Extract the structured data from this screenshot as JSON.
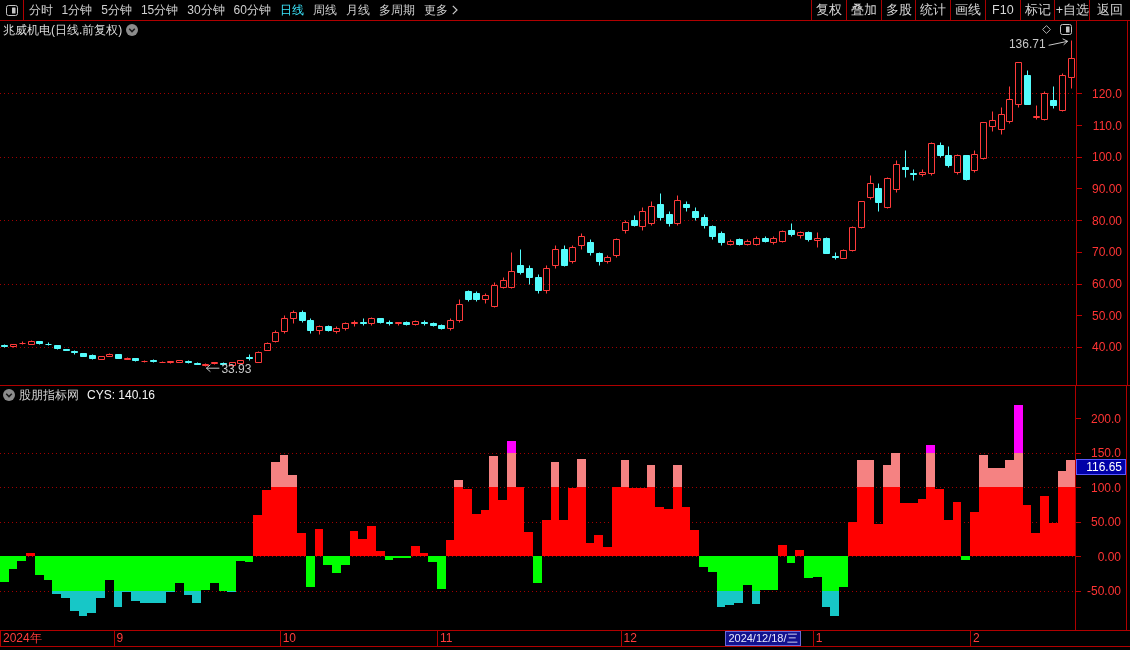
{
  "toolbar": {
    "tabs": [
      {
        "label": "分时",
        "selected": false,
        "kind": "period"
      },
      {
        "label": "1分钟",
        "selected": false,
        "kind": "period"
      },
      {
        "label": "5分钟",
        "selected": false,
        "kind": "period"
      },
      {
        "label": "15分钟",
        "selected": false,
        "kind": "period"
      },
      {
        "label": "30分钟",
        "selected": false,
        "kind": "period"
      },
      {
        "label": "60分钟",
        "selected": false,
        "kind": "period"
      },
      {
        "label": "日线",
        "selected": true,
        "kind": "period"
      },
      {
        "label": "周线",
        "selected": false,
        "kind": "period"
      },
      {
        "label": "月线",
        "selected": false,
        "kind": "period"
      },
      {
        "label": "多周期",
        "selected": false,
        "kind": "period"
      },
      {
        "label": "更多",
        "selected": false,
        "kind": "menu"
      }
    ],
    "buttons": [
      "复权",
      "叠加",
      "多股",
      "统计",
      "画线",
      "F10",
      "标记",
      "+自选",
      "返回"
    ]
  },
  "price_chart": {
    "title": "兆威机电(日线.前复权)",
    "axis_labels": [
      "120.0",
      "110.0",
      "100.0",
      "90.00",
      "80.00",
      "70.00",
      "60.00",
      "50.00",
      "40.00"
    ],
    "high_label": "136.71",
    "low_label": "33.93"
  },
  "indicator": {
    "name": "股朋指标网",
    "reading": "CYS: 140.16",
    "value_tag": "116.65",
    "chart_data": {
      "type": "bar",
      "ylim": [
        -107,
        246.5
      ],
      "grid": true,
      "yticks": [
        {
          "value": 200,
          "label": "200.0"
        },
        {
          "value": 150,
          "label": "150.0"
        },
        {
          "value": 100,
          "label": "100.0"
        },
        {
          "value": 50,
          "label": "50.00"
        },
        {
          "value": 0,
          "label": "0.00"
        },
        {
          "value": -50,
          "label": "-50.00"
        }
      ],
      "values": [
        -37,
        -18,
        -7,
        4,
        -28,
        -34,
        -55,
        -60,
        -80,
        -86,
        -83,
        -60,
        -35,
        -73,
        -52,
        -65,
        -68,
        -68,
        -68,
        -52,
        -39,
        -57,
        -68,
        -49,
        -39,
        -51,
        -52,
        -7,
        -9,
        59,
        96,
        136,
        146,
        117,
        33,
        -45,
        40,
        -13,
        -25,
        -13,
        36,
        25,
        43,
        7,
        -6,
        -3,
        -3,
        14,
        4,
        -9,
        -48,
        23,
        110,
        97,
        61,
        67,
        145,
        81,
        167,
        100,
        35,
        -39,
        52,
        136,
        52,
        99,
        141,
        19,
        30,
        13,
        100,
        140,
        99,
        99,
        132,
        71,
        68,
        132,
        71,
        38,
        -16,
        -23,
        -74,
        -71,
        -68,
        -42,
        -70,
        -49,
        -49,
        16,
        -10,
        9,
        -32,
        -30,
        -74,
        -86,
        -45,
        49,
        139,
        139,
        46,
        132,
        149,
        77,
        77,
        83,
        161,
        97,
        52,
        78,
        -6,
        64,
        146,
        128,
        128,
        139,
        219,
        74,
        33,
        87,
        48,
        123,
        140
      ]
    }
  },
  "time_axis": {
    "labels": [
      "2024年",
      "9",
      "10",
      "11",
      "12",
      "1",
      "2"
    ],
    "cursor_label": "2024/12/18/三"
  }
}
